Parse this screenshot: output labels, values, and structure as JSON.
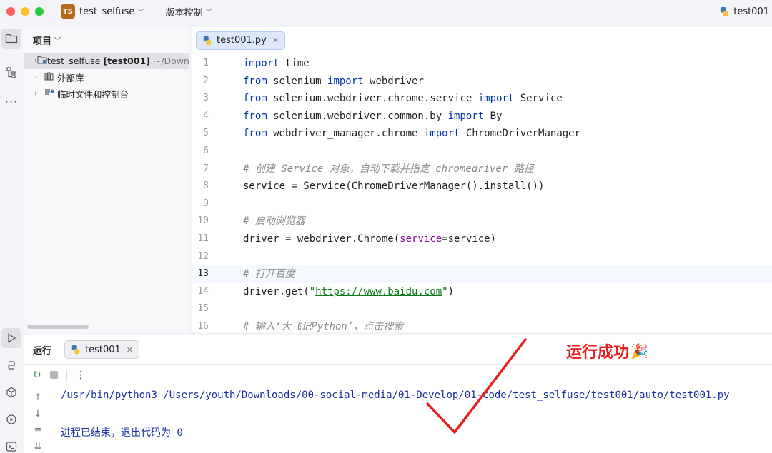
{
  "titlebar": {
    "project_badge": "TS",
    "project_name": "test_selfuse",
    "vcs_label": "版本控制",
    "run_config": "test001"
  },
  "project_panel": {
    "title": "项目",
    "tree": [
      {
        "name": "test_selfuse",
        "detail": "[test001]",
        "path": "~/Down",
        "icon": "folder-icon"
      },
      {
        "name": "外部库",
        "icon": "library-icon"
      },
      {
        "name": "临时文件和控制台",
        "icon": "scratch-icon"
      }
    ]
  },
  "editor": {
    "tab_label": "test001.py",
    "line_numbers": [
      "1",
      "2",
      "3",
      "4",
      "5",
      "6",
      "7",
      "8",
      "9",
      "10",
      "11",
      "12",
      "13",
      "14",
      "15",
      "16"
    ],
    "current_line": 13,
    "code": {
      "l1": {
        "kw": "import",
        "rest": " time"
      },
      "l2": {
        "kw1": "from",
        "mid": " selenium ",
        "kw2": "import",
        "rest": " webdriver"
      },
      "l3": {
        "kw1": "from",
        "mid": " selenium.webdriver.chrome.service ",
        "kw2": "import",
        "rest": " Service"
      },
      "l4": {
        "kw1": "from",
        "mid": " selenium.webdriver.common.by ",
        "kw2": "import",
        "rest": " By"
      },
      "l5": {
        "kw1": "from",
        "mid": " webdriver_manager.chrome ",
        "kw2": "import",
        "rest": " ChromeDriverManager"
      },
      "l7": "# 创建 Service 对象，自动下载并指定 chromedriver 路径",
      "l8": "service = Service(ChromeDriverManager().install())",
      "l10": "# 启动浏览器",
      "l11": {
        "a": "driver = webdriver.Chrome(",
        "param": "service",
        "b": "=service)"
      },
      "l13": "# 打开百度",
      "l14": {
        "a": "driver.get(",
        "q1": "\"",
        "url": "https://www.baidu.com",
        "q2": "\"",
        "b": ")"
      },
      "l16": "# 输入‘大飞记Python’，点击搜索"
    }
  },
  "run_panel": {
    "title": "运行",
    "tab_label": "test001",
    "console": [
      "/usr/bin/python3 /Users/youth/Downloads/00-social-media/01-Develop/01-code/test_selfuse/test001/auto/test001.py",
      "进程已结束，退出代码为 0"
    ]
  },
  "annotation": {
    "text": "运行成功",
    "emoji": "🎉",
    "color": "#e42020"
  },
  "colors": {
    "traffic_red": "#ff5f57",
    "traffic_yellow": "#febc2e",
    "traffic_green": "#28c840",
    "keyword": "#0033b3",
    "comment": "#8c8c8c",
    "string": "#067d17",
    "console_text": "#1a2fa3"
  }
}
